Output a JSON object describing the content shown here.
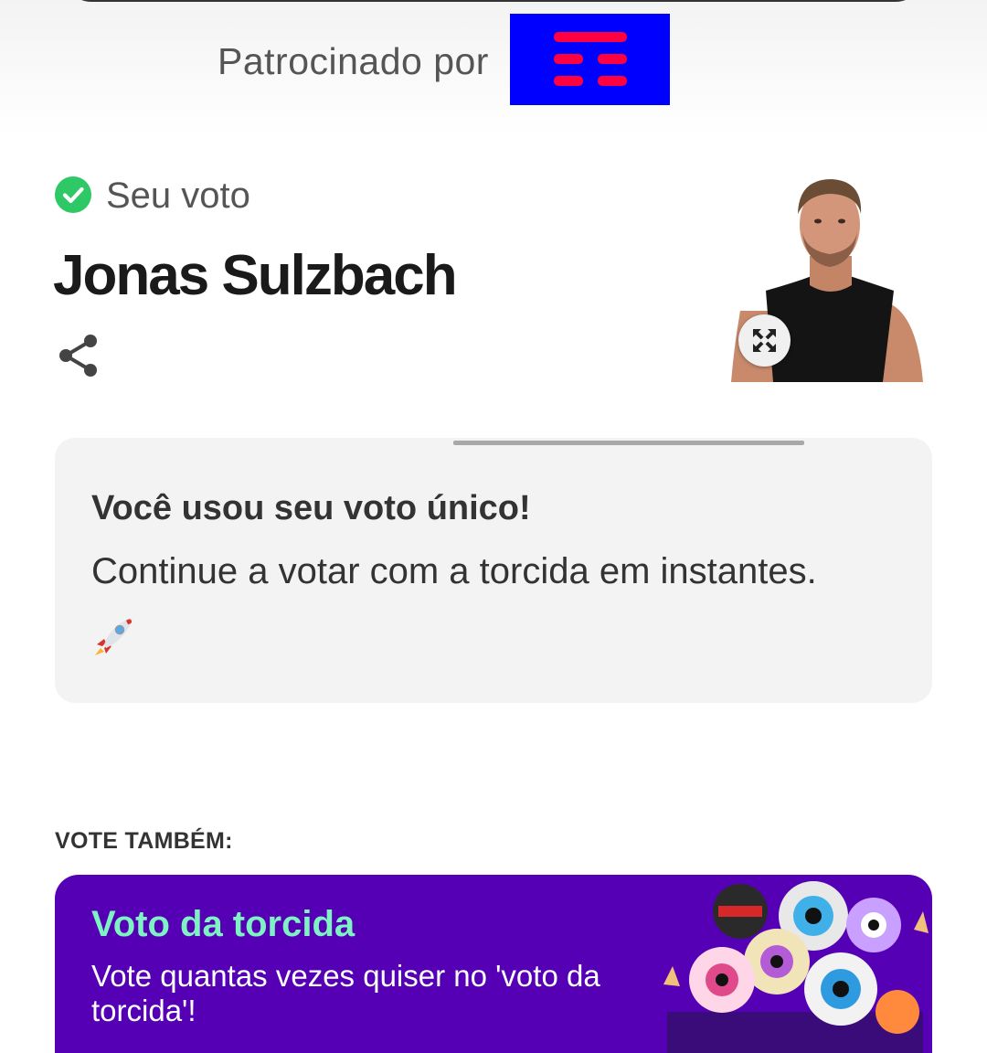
{
  "sponsor": {
    "label": "Patrocinado por",
    "logo_icon": "tim-logo-icon",
    "logo_bg_color": "#0000ff",
    "logo_bar_color": "#ff0040"
  },
  "vote": {
    "status_icon": "check-circle-icon",
    "status_color": "#2ec866",
    "label": "Seu voto",
    "candidate_name": "Jonas Sulzbach",
    "share_icon": "share-icon",
    "expand_icon": "expand-icon"
  },
  "notice": {
    "title": "Você usou seu voto único!",
    "text": "Continue a votar com a torcida em instantes.",
    "emoji_icon": "rocket-icon"
  },
  "also_vote": {
    "heading": "VOTE TAMBÉM:",
    "card": {
      "title": "Voto da torcida",
      "text": "Vote quantas vezes quiser no 'voto da torcida'!",
      "bg_color": "#5500b5",
      "title_color": "#7ff2c4"
    }
  }
}
